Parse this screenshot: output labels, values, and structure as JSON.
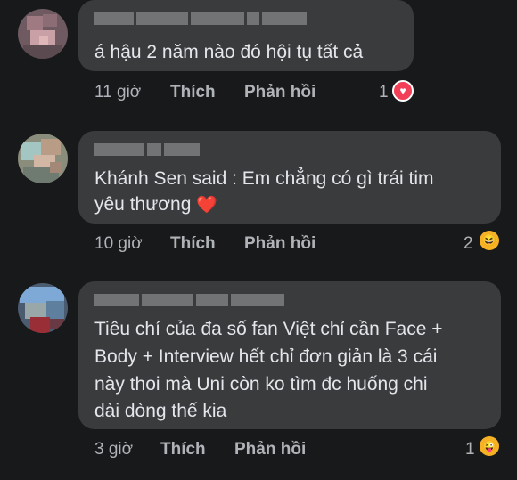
{
  "comments": [
    {
      "text_lines": [
        "á hậu 2 năm nào đó hội tụ tất cả"
      ],
      "time": "11 giờ",
      "like": "Thích",
      "reply": "Phản hồi",
      "reactions": {
        "count": "1",
        "icon": "love-reaction-icon"
      }
    },
    {
      "text_lines": [
        "Khánh Sen said : Em chẳng có gì trái tim",
        "yêu thương"
      ],
      "inline_emoji": "❤️",
      "time": "10 giờ",
      "like": "Thích",
      "reply": "Phản hồi",
      "reactions": {
        "count": "2",
        "icon": "haha-reaction-icon"
      }
    },
    {
      "text_lines": [
        "Tiêu chí của đa số fan Việt chỉ cần Face +",
        "Body + Interview hết chỉ đơn giản là 3 cái",
        "này thoi mà Uni còn ko tìm đc huống chi",
        "dài dòng thế kia"
      ],
      "time": "3 giờ",
      "like": "Thích",
      "reply": "Phản hồi",
      "reactions": {
        "count": "1",
        "icon": "tongue-face-reaction-icon"
      }
    }
  ],
  "colors": {
    "background": "#18191a",
    "bubble": "#3a3b3c",
    "text": "#e4e6eb",
    "meta": "#b0b3b8",
    "love": "#f33e58",
    "haha": "#f7b125"
  }
}
